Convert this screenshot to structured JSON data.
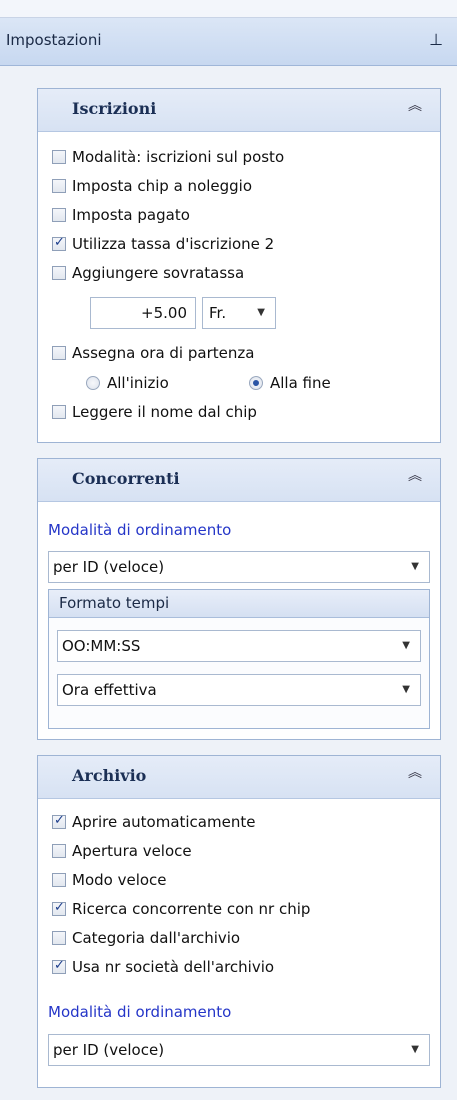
{
  "header": {
    "title": "Impostazioni",
    "pin_icon": "pin-icon"
  },
  "iscrizioni": {
    "title": "Iscrizioni",
    "options": [
      {
        "label": "Modalità: iscrizioni sul posto",
        "checked": false
      },
      {
        "label": "Imposta chip a noleggio",
        "checked": false
      },
      {
        "label": "Imposta pagato",
        "checked": false
      },
      {
        "label": "Utilizza tassa d'iscrizione 2",
        "checked": true
      },
      {
        "label": "Aggiungere sovratassa",
        "checked": false
      }
    ],
    "surcharge_value": "+5.00",
    "surcharge_unit": "Fr.",
    "start_time": {
      "label": "Assegna ora di partenza",
      "checked": false
    },
    "radio_start": {
      "label": "All'inizio",
      "selected": false
    },
    "radio_end": {
      "label": "Alla fine",
      "selected": true
    },
    "read_name": {
      "label": "Leggere il nome dal chip",
      "checked": false
    }
  },
  "concorrenti": {
    "title": "Concorrenti",
    "sort_label": "Modalità di ordinamento",
    "sort_value": "per ID (veloce)",
    "time_format_title": "Formato tempi",
    "time_format_value": "OO:MM:SS",
    "time_type_value": "Ora effettiva"
  },
  "archivio": {
    "title": "Archivio",
    "options": [
      {
        "label": "Aprire automaticamente",
        "checked": true
      },
      {
        "label": "Apertura veloce",
        "checked": false
      },
      {
        "label": "Modo veloce",
        "checked": false
      },
      {
        "label": "Ricerca concorrente con nr chip",
        "checked": true
      },
      {
        "label": "Categoria dall'archivio",
        "checked": false
      },
      {
        "label": "Usa nr società dell'archivio",
        "checked": true
      }
    ],
    "sort_label": "Modalità di ordinamento",
    "sort_value": "per ID (veloce)"
  }
}
